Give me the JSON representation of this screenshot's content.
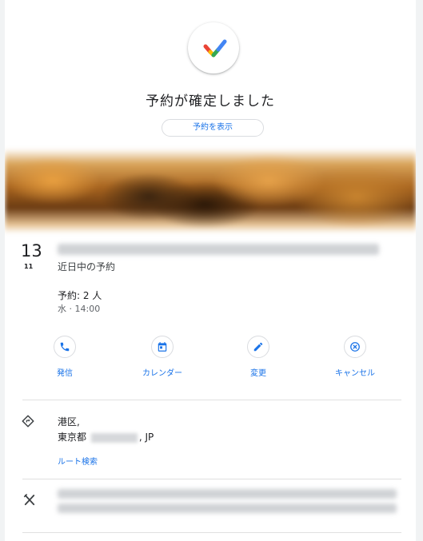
{
  "confirmation": {
    "title": "予約が確定しました",
    "view_button": "予約を表示"
  },
  "reservation": {
    "day": "13",
    "month": "11",
    "status": "近日中の予約",
    "party": "予約: 2 人",
    "datetime": "水 · 14:00"
  },
  "actions": [
    {
      "label": "発信",
      "icon": "phone-icon"
    },
    {
      "label": "カレンダー",
      "icon": "calendar-icon"
    },
    {
      "label": "変更",
      "icon": "pencil-icon"
    },
    {
      "label": "キャンセル",
      "icon": "cancel-icon"
    }
  ],
  "address": {
    "line1": "港区,",
    "line2_prefix": "東京都 ",
    "line2_suffix": ", JP",
    "route_link": "ルート検索"
  },
  "colors": {
    "accent": "#1a73e8",
    "check_red": "#ea4335",
    "check_yellow": "#fbbc04",
    "check_green": "#34a853",
    "check_blue": "#4285f4"
  }
}
